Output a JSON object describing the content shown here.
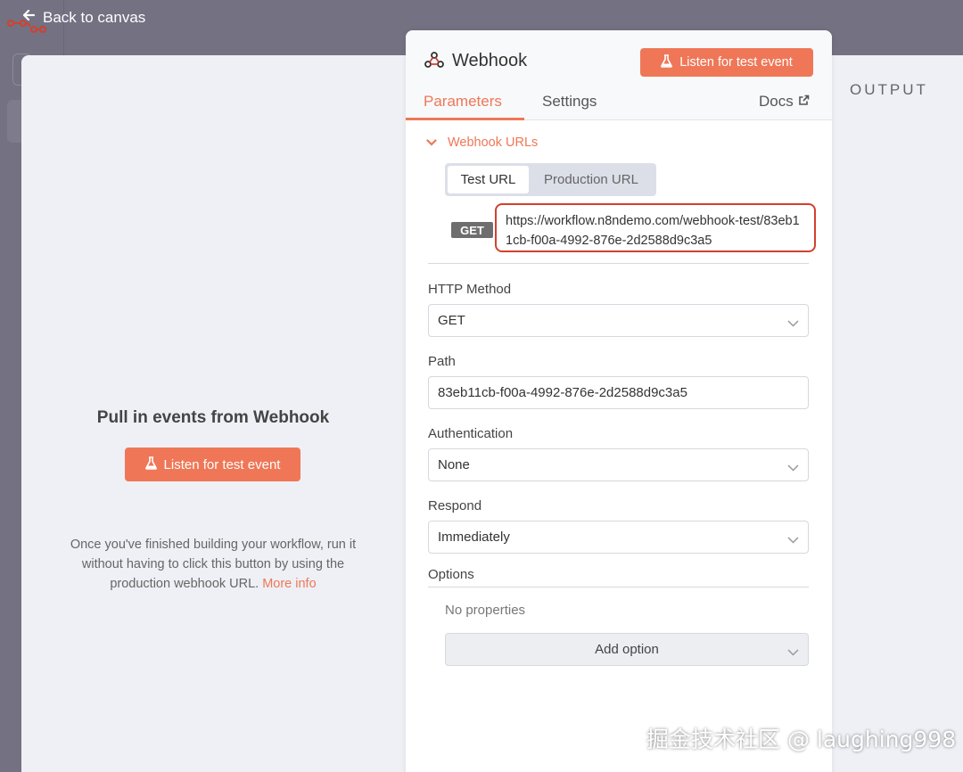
{
  "nav": {
    "back_label": "Back to canvas"
  },
  "input_pane": {
    "title": "Pull in events from Webhook",
    "listen_button": "Listen for test event",
    "hint_line1": "Once you've finished building your workflow, run it",
    "hint_line2": "without having to click this button by using the",
    "hint_line3": "production webhook URL.",
    "more_info": "More info"
  },
  "output_pane": {
    "label": "OUTPUT"
  },
  "node": {
    "title": "Webhook",
    "listen_button": "Listen for test event",
    "tabs": {
      "parameters": "Parameters",
      "settings": "Settings",
      "docs": "Docs"
    },
    "webhook_urls": {
      "section_label": "Webhook URLs",
      "test_tab": "Test URL",
      "production_tab": "Production URL",
      "method_badge": "GET",
      "url": "https://workflow.n8ndemo.com/webhook-test/83eb11cb-f00a-4992-876e-2d2588d9c3a5"
    },
    "fields": {
      "http_method": {
        "label": "HTTP Method",
        "value": "GET"
      },
      "path": {
        "label": "Path",
        "value": "83eb11cb-f00a-4992-876e-2d2588d9c3a5"
      },
      "authentication": {
        "label": "Authentication",
        "value": "None"
      },
      "respond": {
        "label": "Respond",
        "value": "Immediately"
      }
    },
    "options": {
      "label": "Options",
      "empty_text": "No properties",
      "add_button": "Add option"
    }
  },
  "watermark": "掘金技术社区 @ laughing998",
  "colors": {
    "accent": "#ef7757",
    "highlight_border": "#d3402f",
    "backdrop": "#737182",
    "panel_bg": "#ffffff",
    "ndv_bg": "#eef0f5"
  },
  "icons": {
    "back": "arrow-left-icon",
    "logo": "n8n-logo-icon",
    "flask": "flask-icon",
    "webhook": "webhook-icon",
    "external_link": "external-link-icon",
    "chevron": "chevron-down-icon"
  }
}
